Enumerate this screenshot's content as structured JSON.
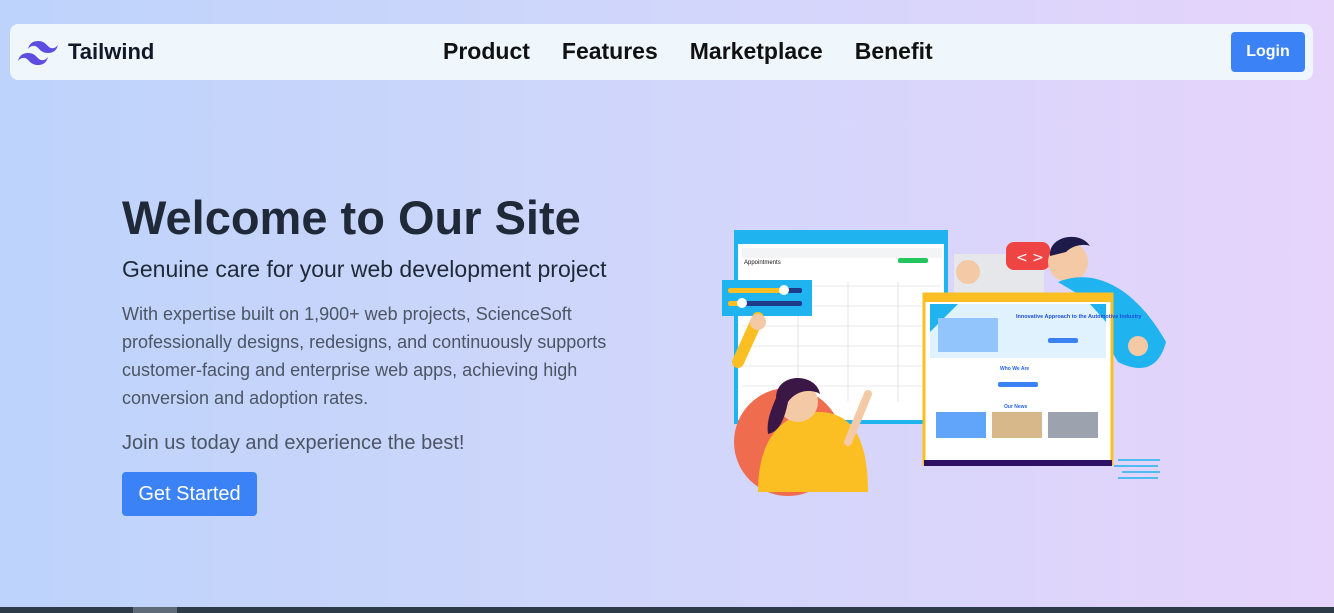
{
  "brand": {
    "name": "Tailwind",
    "logo_icon": "tailwind-logo-icon"
  },
  "nav": {
    "items": [
      {
        "label": "Product"
      },
      {
        "label": "Features"
      },
      {
        "label": "Marketplace"
      },
      {
        "label": "Benefit"
      }
    ]
  },
  "login_label": "Login",
  "hero": {
    "title": "Welcome to Our Site",
    "subtitle": "Genuine care for your web development project",
    "description": "With expertise built on 1,900+ web projects, ScienceSoft professionally designs, redesigns, and continuously supports customer-facing and enterprise web apps, achieving high conversion and adoption rates.",
    "cta_text": "Join us today and experience the best!",
    "button_label": "Get Started"
  },
  "illustration": {
    "appointments_title": "Appointments",
    "website_headline": "Innovative Approach to the Automotive Industry",
    "who_we_are": "Who We Are",
    "our_news": "Our News"
  },
  "colors": {
    "primary": "#3b82f6",
    "heading": "#1f2937",
    "body_text": "#4b5563",
    "navbar_bg": "#eff6fc"
  }
}
